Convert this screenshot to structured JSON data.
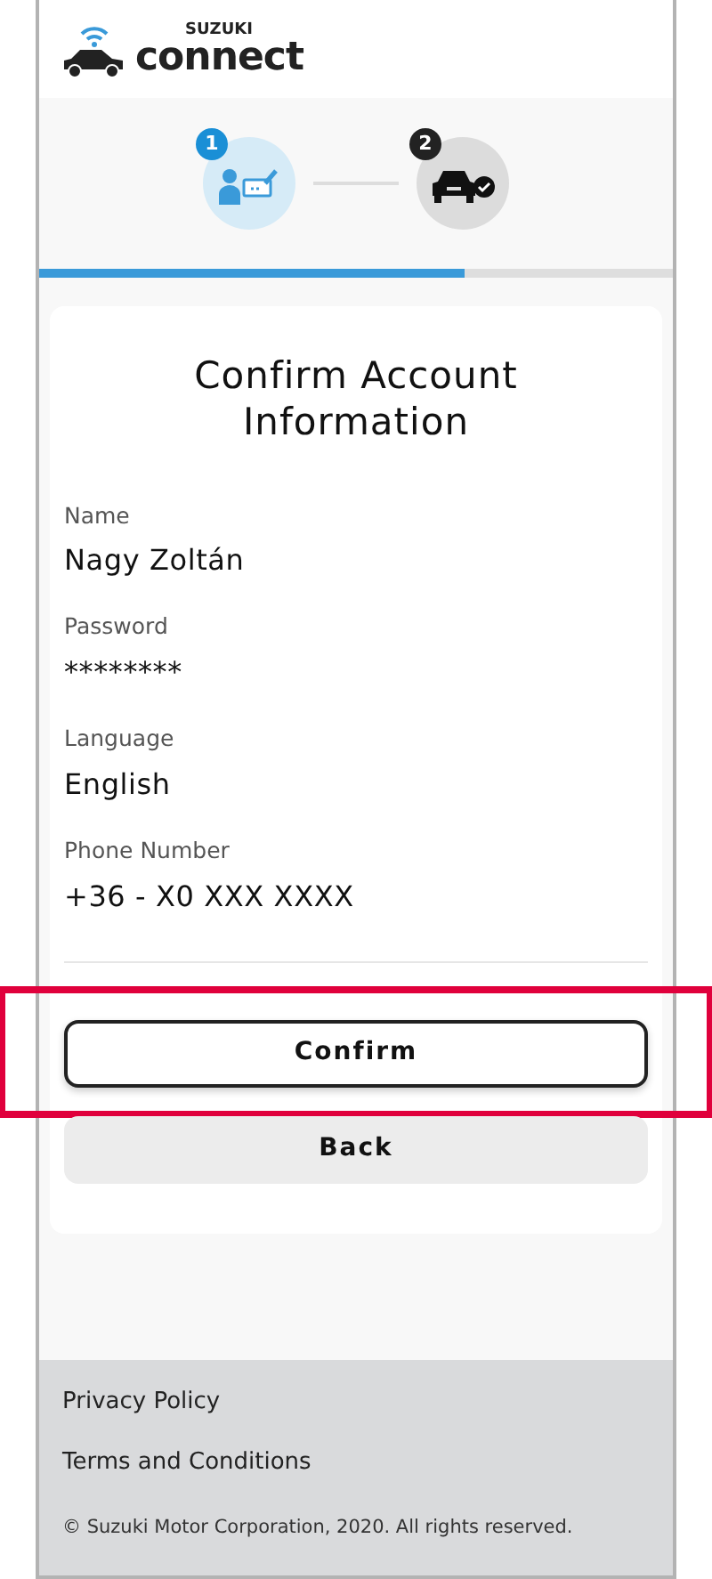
{
  "logo": {
    "brand": "SUZUKI",
    "product": "connect"
  },
  "steps": [
    {
      "number": "1",
      "kind": "account",
      "selected": true
    },
    {
      "number": "2",
      "kind": "vehicle",
      "selected": false
    }
  ],
  "progress": {
    "level": 0.67
  },
  "title": "Confirm Account Information",
  "fields": [
    {
      "label": "Name",
      "value": "Nagy Zoltán"
    },
    {
      "label": "Password",
      "value": "********"
    },
    {
      "label": "Language",
      "value": "English"
    },
    {
      "label": "Phone Number",
      "value": "+36 - X0 XXX XXXX"
    }
  ],
  "buttons": [
    {
      "label": "Confirm",
      "kind": "outline",
      "highlighted": true
    },
    {
      "label": "Back",
      "kind": "grey",
      "highlighted": false
    }
  ],
  "footer": {
    "links": [
      "Privacy Policy",
      "Terms and Conditions"
    ],
    "copyright": "© Suzuki Motor Corporation, 2020. All rights reserved."
  }
}
